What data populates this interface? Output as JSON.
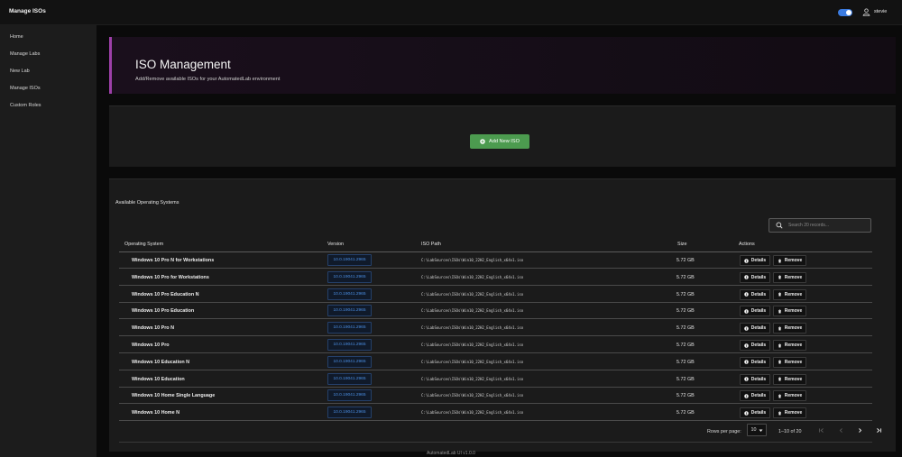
{
  "app": {
    "title": "Manage ISOs",
    "user": "stevie",
    "theme_toggle_on": true,
    "accent": "#3b7be0"
  },
  "sidebar": {
    "items": [
      {
        "label": "Home"
      },
      {
        "label": "Manage Labs"
      },
      {
        "label": "New Lab"
      },
      {
        "label": "Manage ISOs"
      },
      {
        "label": "Custom Roles"
      }
    ]
  },
  "header": {
    "title": "ISO Management",
    "subtitle": "Add/Remove available ISOs for your AutomatedLab environment",
    "accent": "#9d3fa8"
  },
  "actions": {
    "add_label": "Add New ISO",
    "add_color": "#4c9b4f"
  },
  "table": {
    "section_title": "Available Operating Systems",
    "search_placeholder": "Search 20 records...",
    "columns": [
      "Operating System",
      "Version",
      "ISO Path",
      "Size",
      "Actions"
    ],
    "details_label": "Details",
    "remove_label": "Remove",
    "rows": [
      {
        "os": "Windows 10 Pro N for Workstations",
        "version": "10.0.19041.2965",
        "path": "C:\\LabSources\\ISOs\\Win10_22H2_English_x64v1.iso",
        "size": "5.72 GB"
      },
      {
        "os": "Windows 10 Pro for Workstations",
        "version": "10.0.19041.2965",
        "path": "C:\\LabSources\\ISOs\\Win10_22H2_English_x64v1.iso",
        "size": "5.72 GB"
      },
      {
        "os": "Windows 10 Pro Education N",
        "version": "10.0.19041.2965",
        "path": "C:\\LabSources\\ISOs\\Win10_22H2_English_x64v1.iso",
        "size": "5.72 GB"
      },
      {
        "os": "Windows 10 Pro Education",
        "version": "10.0.19041.2965",
        "path": "C:\\LabSources\\ISOs\\Win10_22H2_English_x64v1.iso",
        "size": "5.72 GB"
      },
      {
        "os": "Windows 10 Pro N",
        "version": "10.0.19041.2965",
        "path": "C:\\LabSources\\ISOs\\Win10_22H2_English_x64v1.iso",
        "size": "5.72 GB"
      },
      {
        "os": "Windows 10 Pro",
        "version": "10.0.19041.2965",
        "path": "C:\\LabSources\\ISOs\\Win10_22H2_English_x64v1.iso",
        "size": "5.72 GB"
      },
      {
        "os": "Windows 10 Education N",
        "version": "10.0.19041.2965",
        "path": "C:\\LabSources\\ISOs\\Win10_22H2_English_x64v1.iso",
        "size": "5.72 GB"
      },
      {
        "os": "Windows 10 Education",
        "version": "10.0.19041.2965",
        "path": "C:\\LabSources\\ISOs\\Win10_22H2_English_x64v1.iso",
        "size": "5.72 GB"
      },
      {
        "os": "Windows 10 Home Single Language",
        "version": "10.0.19041.2965",
        "path": "C:\\LabSources\\ISOs\\Win10_22H2_English_x64v1.iso",
        "size": "5.72 GB"
      },
      {
        "os": "Windows 10 Home N",
        "version": "10.0.19041.2965",
        "path": "C:\\LabSources\\ISOs\\Win10_22H2_English_x64v1.iso",
        "size": "5.72 GB"
      }
    ]
  },
  "pager": {
    "rows_label": "Rows per page:",
    "rows_value": "10",
    "range": "1–10 of 20"
  },
  "footer": {
    "text": "AutomatedLab UI v1.0.0"
  },
  "icons": {
    "user": "account-icon",
    "search": "search-icon",
    "add": "plus-circle-icon",
    "details": "info-circle-icon",
    "remove": "trash-icon"
  }
}
